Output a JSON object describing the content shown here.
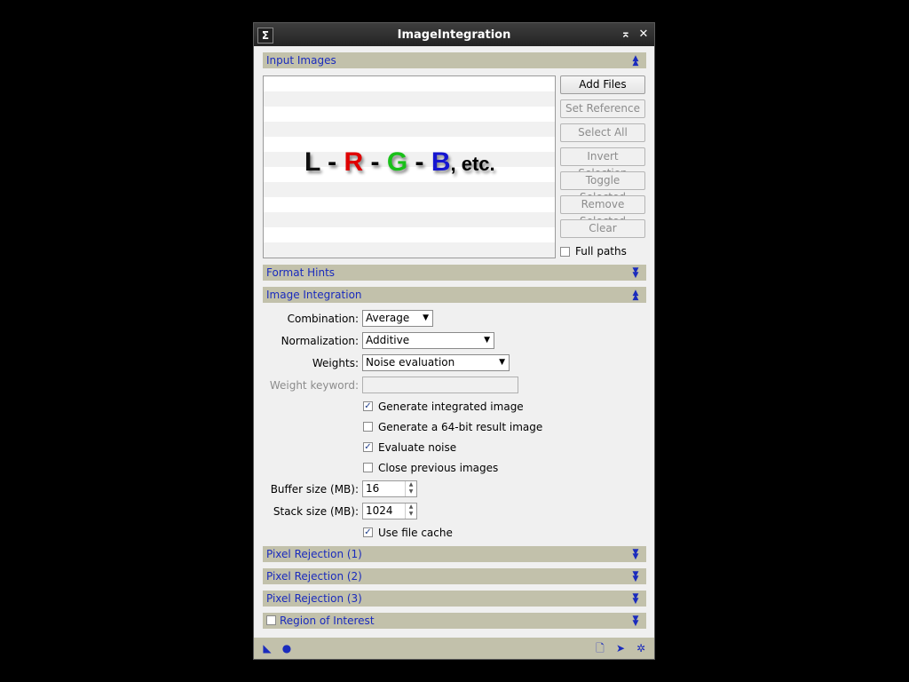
{
  "window": {
    "title": "ImageIntegration",
    "sys_icon": "Σ",
    "minimize_glyph": "⌅",
    "close_glyph": "✕"
  },
  "sections": {
    "input_images": "Input Images",
    "format_hints": "Format Hints",
    "image_integration": "Image Integration",
    "pixel_rejection_1": "Pixel Rejection (1)",
    "pixel_rejection_2": "Pixel Rejection (2)",
    "pixel_rejection_3": "Pixel Rejection (3)",
    "region_of_interest": "Region of Interest"
  },
  "placeholder_art": {
    "L": "L",
    "dash1": " - ",
    "R": "R",
    "dash2": " - ",
    "G": "G",
    "dash3": " - ",
    "B": "B",
    "etc": ", etc.",
    "colors": {
      "L": "#111111",
      "R": "#e00000",
      "G": "#19c019",
      "B": "#1515d0"
    }
  },
  "buttons": {
    "add_files": "Add Files",
    "set_reference": "Set Reference",
    "select_all": "Select All",
    "invert_selection": "Invert Selection",
    "toggle_selected": "Toggle Selected",
    "remove_selected": "Remove Selected",
    "clear": "Clear"
  },
  "full_paths": {
    "label": "Full paths",
    "checked": false
  },
  "integration": {
    "combination_label": "Combination:",
    "combination_value": "Average",
    "normalization_label": "Normalization:",
    "normalization_value": "Additive",
    "weights_label": "Weights:",
    "weights_value": "Noise evaluation",
    "weight_keyword_label": "Weight keyword:",
    "weight_keyword_value": "",
    "gen_integrated": {
      "label": "Generate integrated image",
      "checked": true
    },
    "gen_64bit": {
      "label": "Generate a 64-bit result image",
      "checked": false
    },
    "evaluate_noise": {
      "label": "Evaluate noise",
      "checked": true
    },
    "close_previous": {
      "label": "Close previous images",
      "checked": false
    },
    "buffer_size_label": "Buffer size (MB):",
    "buffer_size_value": "16",
    "stack_size_label": "Stack size (MB):",
    "stack_size_value": "1024",
    "use_file_cache": {
      "label": "Use file cache",
      "checked": true
    }
  },
  "icons": {
    "check_mark": "✓",
    "caret_down": "▼",
    "collapse": "▲",
    "expand": "▼",
    "spin_up": "▲",
    "spin_down": "▼",
    "new_instance": "◣",
    "apply_global": "●",
    "reset": "🗋",
    "preferences": "➤",
    "maximize": "✲"
  },
  "colors": {
    "accent": "#1a2bbd",
    "section_bg": "#c2c1ab",
    "window_bg": "#f0f0f0"
  }
}
